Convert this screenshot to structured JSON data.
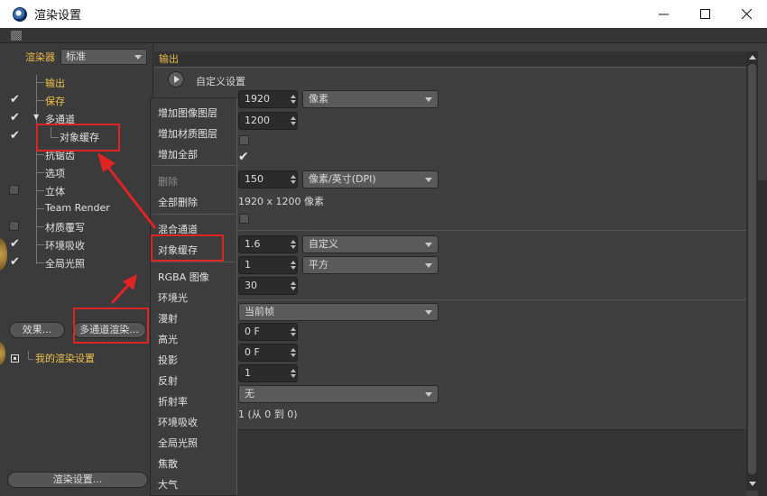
{
  "window": {
    "title": "渲染设置"
  },
  "left_panel": {
    "renderer_label": "渲染器",
    "renderer_value": "标准",
    "tree": [
      {
        "label": "输出",
        "color": "yellow",
        "check": "none"
      },
      {
        "label": "保存",
        "color": "yellow",
        "check": "checked"
      },
      {
        "label": "多通道",
        "color": "white",
        "check": "checked"
      },
      {
        "label": "对象缓存",
        "color": "white",
        "check": "checked"
      },
      {
        "label": "抗锯齿",
        "color": "white",
        "check": "none"
      },
      {
        "label": "选项",
        "color": "white",
        "check": "none"
      },
      {
        "label": "立体",
        "color": "white",
        "check": "empty"
      },
      {
        "label": "Team Render",
        "color": "white",
        "check": "none"
      },
      {
        "label": "材质覆写",
        "color": "white",
        "check": "empty"
      },
      {
        "label": "环境吸收",
        "color": "white",
        "check": "checked"
      },
      {
        "label": "全局光照",
        "color": "white",
        "check": "checked"
      }
    ],
    "effects_button": "效果...",
    "multipass_button": "多通道渲染...",
    "my_render_settings": "我的渲染设置",
    "render_settings_button": "渲染设置..."
  },
  "right_panel": {
    "section_title": "输出",
    "custom_settings": "自定义设置",
    "width_value": "1920",
    "height_value": "1200",
    "unit_pixels": "像素",
    "resolution_value": "150",
    "resolution_unit": "像素/英寸(DPI)",
    "image_size_text": "1920 x 1200 像素",
    "ratio_value": "1.6",
    "ratio_mode": "自定义",
    "pixel_aspect_value": "1",
    "pixel_aspect_mode": "平方",
    "fps_value": "30",
    "frame_range": "当前帧",
    "from_value": "0 F",
    "to_value": "0 F",
    "step_value": "1",
    "fields_value": "无",
    "frames_text": "1 (从 0 到 0)"
  },
  "context_menu": {
    "items": [
      {
        "label": "增加图像图层",
        "disabled": false
      },
      {
        "label": "增加材质图层",
        "disabled": false
      },
      {
        "label": "增加全部",
        "disabled": false
      },
      {
        "label": "删除",
        "disabled": true
      },
      {
        "label": "全部删除",
        "disabled": false
      },
      {
        "label": "混合通道",
        "disabled": false
      },
      {
        "label": "对象缓存",
        "disabled": false
      },
      {
        "label": "RGBA 图像",
        "disabled": false
      },
      {
        "label": "环境光",
        "disabled": false
      },
      {
        "label": "漫射",
        "disabled": false
      },
      {
        "label": "高光",
        "disabled": false
      },
      {
        "label": "投影",
        "disabled": false
      },
      {
        "label": "反射",
        "disabled": false
      },
      {
        "label": "折射率",
        "disabled": false
      },
      {
        "label": "环境吸收",
        "disabled": false
      },
      {
        "label": "全局光照",
        "disabled": false
      },
      {
        "label": "焦散",
        "disabled": false
      },
      {
        "label": "大气",
        "disabled": false
      }
    ]
  },
  "colors": {
    "highlight_red": "#e02424",
    "label_yellow": "#f0c14d",
    "panel_bg": "#3f3f3f"
  }
}
